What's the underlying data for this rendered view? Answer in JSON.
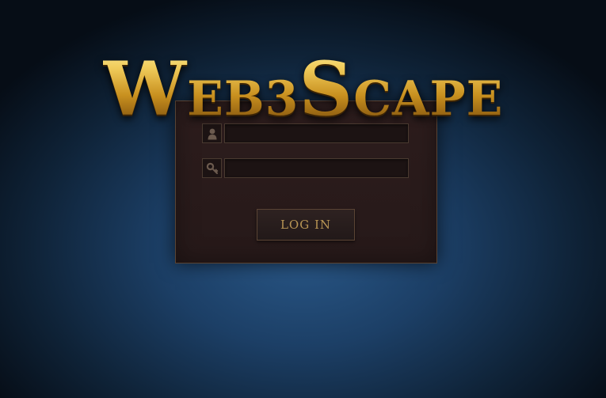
{
  "logo": {
    "w_initial": "W",
    "w_rest": "EB3",
    "s_initial": "S",
    "s_rest": "CAPE"
  },
  "login_form": {
    "username_icon": "user-silhouette-icon",
    "username_value": "",
    "password_icon": "key-icon",
    "password_value": "",
    "login_label": "LOG IN"
  },
  "colors": {
    "background": "#1c3f66",
    "panel": "#2a1c1c",
    "panel_border": "#5a4434",
    "gold": "#d4a43a",
    "button_text": "#b89554"
  }
}
